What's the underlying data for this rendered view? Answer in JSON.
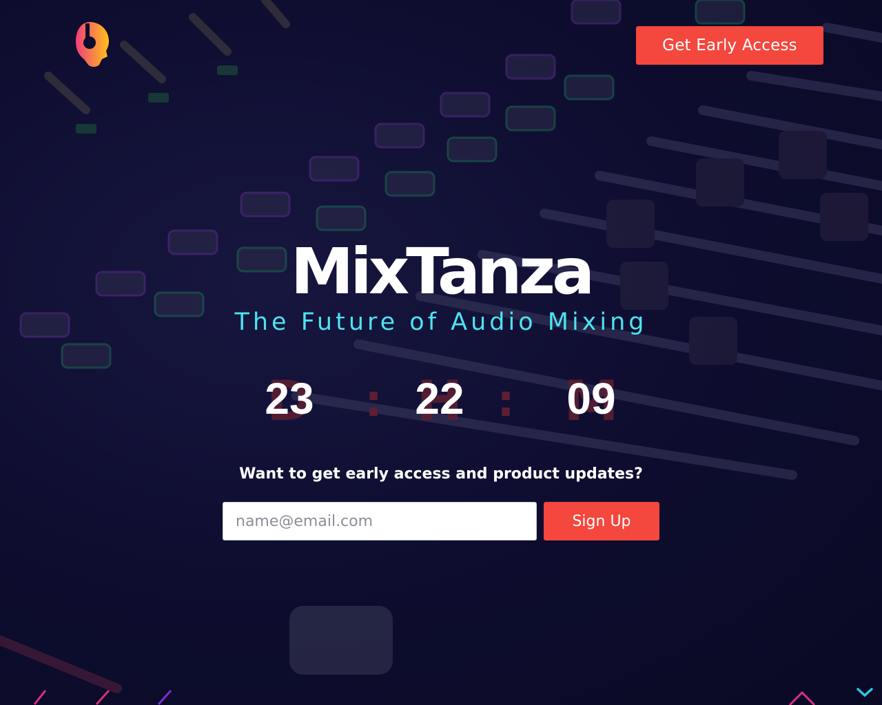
{
  "header": {
    "logo_icon": "headphones-head-logo-icon",
    "cta_label": "Get Early Access"
  },
  "hero": {
    "title": "MixTanza",
    "tagline": "The Future of Audio Mixing"
  },
  "countdown": {
    "days": {
      "value": "23",
      "unit_letter": "D"
    },
    "hours": {
      "value": "22",
      "unit_letter": "H"
    },
    "minutes": {
      "value": "09",
      "unit_letter": "M"
    },
    "separator": ":"
  },
  "signup": {
    "prompt": "Want to get early access and product updates?",
    "email_placeholder": "name@email.com",
    "button_label": "Sign Up"
  },
  "colors": {
    "accent": "#f4473e",
    "tagline": "#4de3ef",
    "background": "#0d0c2e",
    "countdown_ghost": "#5e1f32"
  },
  "icons": {
    "scroll": "chevron-down-icon"
  }
}
